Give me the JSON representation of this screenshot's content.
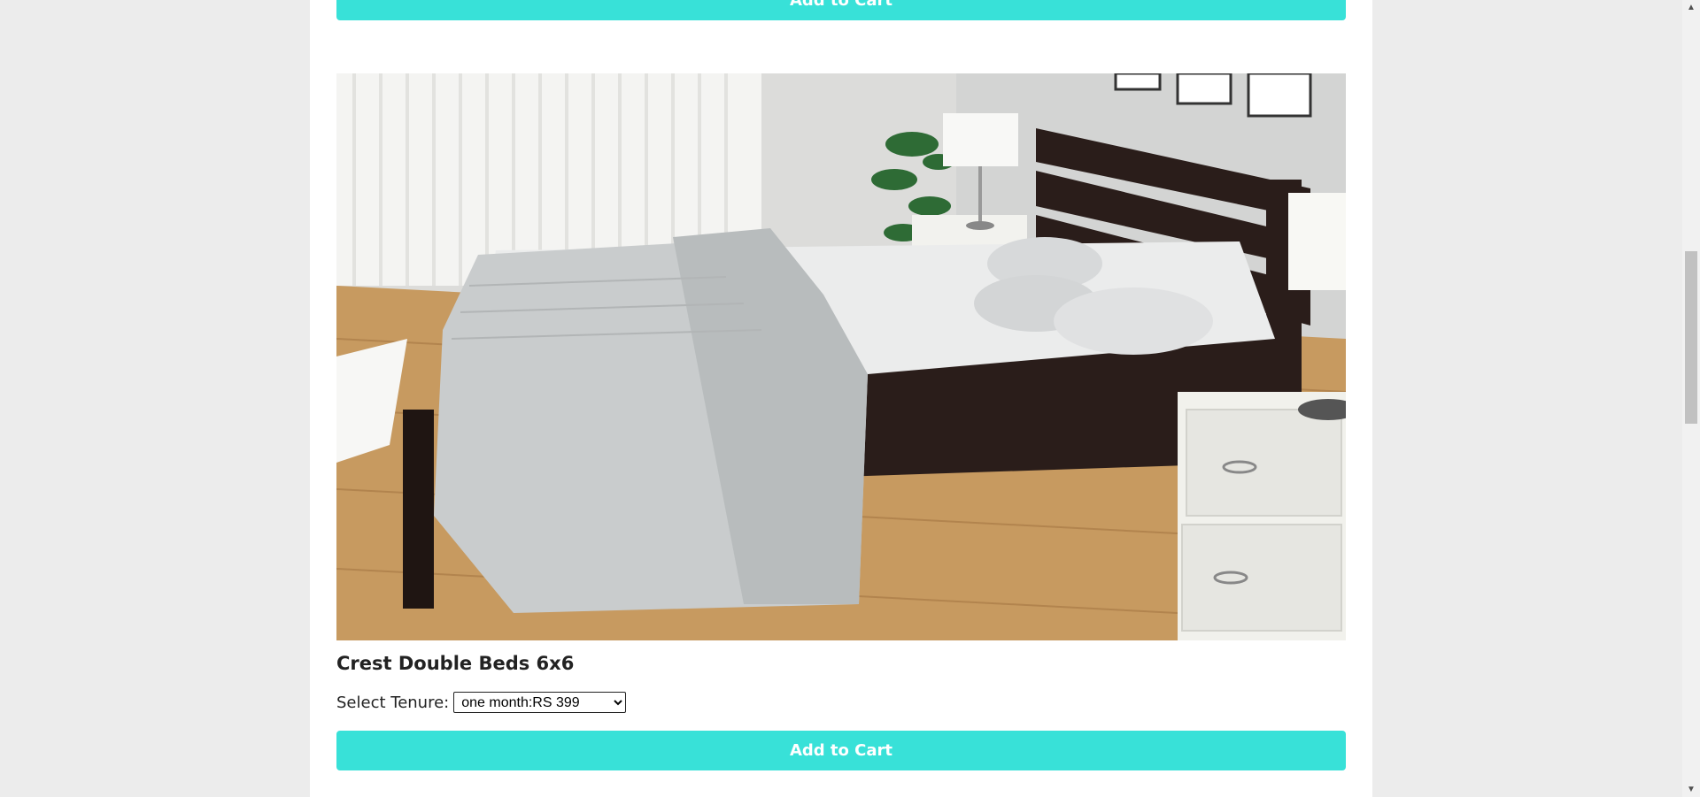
{
  "product_top": {
    "add_to_cart_label": "Add to Cart"
  },
  "product": {
    "title": "Crest Double Beds 6x6",
    "tenure_label": "Select Tenure:",
    "tenure_selected": "one month:RS 399",
    "add_to_cart_label": "Add to Cart",
    "image_alt": "Crest Double Bed with dark wooden headboard in a bedroom"
  },
  "colors": {
    "accent": "#38e1d8",
    "page_bg": "#ececec",
    "panel_bg": "#ffffff"
  },
  "scrollbar": {
    "up_icon": "triangle-up-icon",
    "down_icon": "triangle-down-icon"
  }
}
